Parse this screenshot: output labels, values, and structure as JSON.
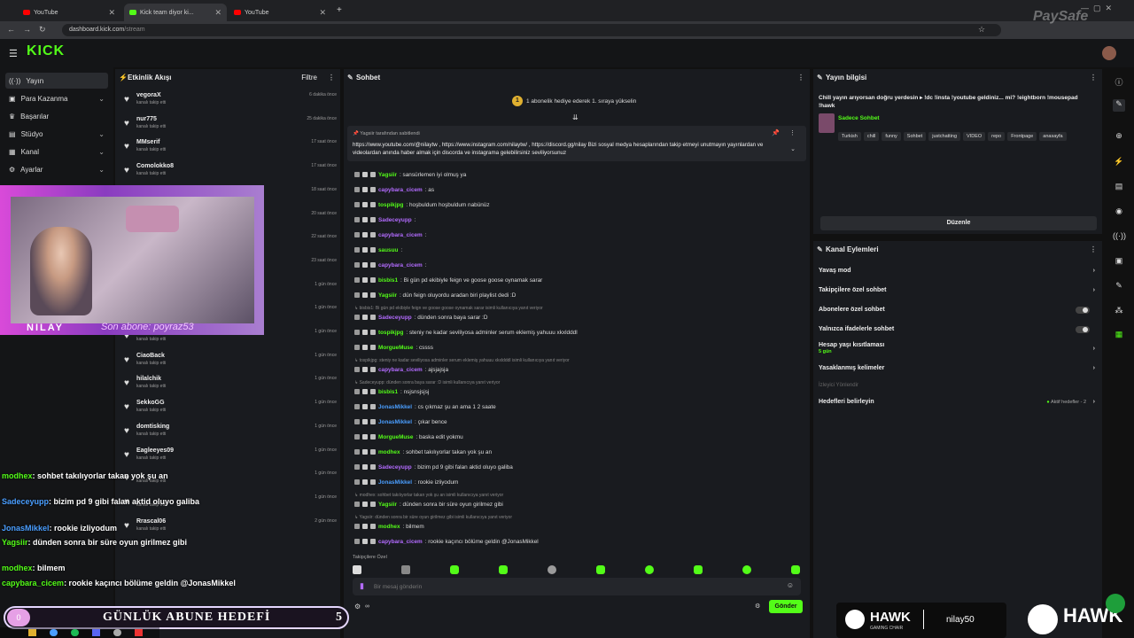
{
  "browser": {
    "tabs": [
      {
        "label": "YouTube",
        "active": false
      },
      {
        "label": "Kick team diyor ki...",
        "active": true
      },
      {
        "label": "YouTube",
        "active": false
      }
    ],
    "url_domain": "dashboard.kick.com",
    "url_path": "/stream"
  },
  "brand": {
    "logo": "KICK",
    "accent": "#53fc18"
  },
  "sidebar": {
    "items": [
      {
        "label": "Yayın",
        "icon": "broadcast-icon",
        "selected": true,
        "has_chevron": false
      },
      {
        "label": "Para Kazanma",
        "icon": "money-icon",
        "has_chevron": true
      },
      {
        "label": "Başarılar",
        "icon": "trophy-icon",
        "has_chevron": false
      },
      {
        "label": "Stüdyo",
        "icon": "studio-icon",
        "has_chevron": true
      },
      {
        "label": "Kanal",
        "icon": "channel-icon",
        "has_chevron": true
      },
      {
        "label": "Ayarlar",
        "icon": "gear-icon",
        "has_chevron": true
      }
    ]
  },
  "activity": {
    "title": "Etkinlik Akışı",
    "filter_label": "Filtre",
    "items": [
      {
        "name": "vegoraX",
        "sub": "kanalı takip etti",
        "time": "6 dakika önce"
      },
      {
        "name": "nur775",
        "sub": "kanalı takip etti",
        "time": "25 dakika önce"
      },
      {
        "name": "MMserif",
        "sub": "kanalı takip etti",
        "time": "17 saat önce"
      },
      {
        "name": "Comolokko8",
        "sub": "kanalı takip etti",
        "time": "17 saat önce"
      },
      {
        "name": "",
        "sub": "",
        "time": "18 saat önce"
      },
      {
        "name": "",
        "sub": "",
        "time": "20 saat önce"
      },
      {
        "name": "",
        "sub": "",
        "time": "22 saat önce"
      },
      {
        "name": "",
        "sub": "",
        "time": "23 saat önce"
      },
      {
        "name": "",
        "sub": "",
        "time": "1 gün önce"
      },
      {
        "name": "",
        "sub": "",
        "time": "1 gün önce"
      },
      {
        "name": "",
        "sub": "kanalı takip etti",
        "time": "1 gün önce"
      },
      {
        "name": "CiaoBack",
        "sub": "kanalı takip etti",
        "time": "1 gün önce"
      },
      {
        "name": "hilalchik",
        "sub": "kanalı takip etti",
        "time": "1 gün önce"
      },
      {
        "name": "SekkoGG",
        "sub": "kanalı takip etti",
        "time": "1 gün önce"
      },
      {
        "name": "domtisking",
        "sub": "kanalı takip etti",
        "time": "1 gün önce"
      },
      {
        "name": "Eagleeyes09",
        "sub": "kanalı takip etti",
        "time": "1 gün önce"
      },
      {
        "name": "",
        "sub": "kanalı takip etti",
        "time": "1 gün önce"
      },
      {
        "name": "",
        "sub": "kanalı takip etti",
        "time": "1 gün önce"
      },
      {
        "name": "Rrascal06",
        "sub": "kanalı takip etti",
        "time": "2 gün önce"
      }
    ]
  },
  "chat": {
    "title": "Sohbet",
    "gift_banner": "1 abonelik hediye ederek 1. sıraya yükselin",
    "pinned_by": "Yagsiir tarafından sabitlendi",
    "pinned_text": "https://www.youtube.com/@nilaytw , https://www.instagram.com/nilaytw/ , https://discord.gg/nilay Bizi sosyal medya hesaplarından takip etmeyi unutmayın yayınlardan ve videolardan anında haber almak için discorda ve instagrama gelebilirsiniz seviliyorsunuz",
    "messages": [
      {
        "kind": "msg",
        "user": "Yagsiir",
        "color": "#53fc18",
        "text": ": sansürlemen iyi olmuş ya"
      },
      {
        "kind": "msg",
        "user": "capybara_cicem",
        "color": "#b36bff",
        "text": ": as"
      },
      {
        "kind": "msg",
        "user": "tospikjpg",
        "color": "#53fc18",
        "text": ": hoşbuldum hoşbuldum nabünüz"
      },
      {
        "kind": "msg",
        "user": "Sadeceyupp",
        "color": "#b36bff",
        "text": ":"
      },
      {
        "kind": "msg",
        "user": "capybara_cicem",
        "color": "#b36bff",
        "text": ":"
      },
      {
        "kind": "msg",
        "user": "sausuu",
        "color": "#53fc18",
        "text": ":"
      },
      {
        "kind": "msg",
        "user": "capybara_cicem",
        "color": "#b36bff",
        "text": ":"
      },
      {
        "kind": "msg",
        "user": "bisbis1",
        "color": "#53fc18",
        "text": ": Bi gün pd ekibiyle feign ve goose goose oynamak sarar"
      },
      {
        "kind": "msg",
        "user": "Yagsiir",
        "color": "#53fc18",
        "text": ": dün feign oluyordu aradan biri playlist dedi :D"
      },
      {
        "kind": "reply",
        "text": "bisbis1: Bi gün pd ekibiyle feign ve goose goose oynamak sarar isimli kullanıcıya yanıt veriyor"
      },
      {
        "kind": "msg",
        "user": "Sadeceyupp",
        "color": "#b36bff",
        "text": ": dünden sonra baya sarar :D"
      },
      {
        "kind": "msg",
        "user": "tospikjpg",
        "color": "#53fc18",
        "text": ": steniy ne kadar seviliyosa adminler serum eklemiş yahuuu xkxldddl"
      },
      {
        "kind": "msg",
        "user": "MorgueMuse",
        "color": "#53fc18",
        "text": ": cssss"
      },
      {
        "kind": "reply",
        "text": "tospikjpg: steniy ne kadar seviliyosa adminler serum eklemiş yahuuu xkxldddl isimli kullanıcıya yanıt veriyor"
      },
      {
        "kind": "msg",
        "user": "capybara_cicem",
        "color": "#b36bff",
        "text": ": ajsjajsja"
      },
      {
        "kind": "reply",
        "text": "Sadeceyupp: dünden sonra baya sarar :D isimli kullanıcıya yanıt veriyor"
      },
      {
        "kind": "msg",
        "user": "bisbis1",
        "color": "#53fc18",
        "text": ": nsjsnsjsjsj"
      },
      {
        "kind": "msg",
        "user": "JonasMikkel",
        "color": "#4a9eff",
        "text": ": cs çıkmaz şu an ama 1 2 saate"
      },
      {
        "kind": "msg",
        "user": "JonasMikkel",
        "color": "#4a9eff",
        "text": ": çıkar bence"
      },
      {
        "kind": "msg",
        "user": "MorgueMuse",
        "color": "#53fc18",
        "text": ": baska edit yokmu"
      },
      {
        "kind": "msg",
        "user": "modhex",
        "color": "#53fc18",
        "text": ": sohbet takılıyorlar takan yok şu an"
      },
      {
        "kind": "msg",
        "user": "Sadeceyupp",
        "color": "#b36bff",
        "text": ": bizim pd 9 gibi falan aktid oluyo galiba"
      },
      {
        "kind": "msg",
        "user": "JonasMikkel",
        "color": "#4a9eff",
        "text": ": rookie izliyodum"
      },
      {
        "kind": "reply",
        "text": "modhex: sohbet takılıyorlar takan yok şu an isimli kullanıcıya yanıt veriyor"
      },
      {
        "kind": "msg",
        "user": "Yagsiir",
        "color": "#53fc18",
        "text": ": dünden sonra bir süre oyun girilmez gibi"
      },
      {
        "kind": "reply",
        "text": "Yagsiir: dünden sonra bir süre oyun girilmez gibi isimli kullanıcıya yanıt veriyor"
      },
      {
        "kind": "msg",
        "user": "modhex",
        "color": "#53fc18",
        "text": ": bilmem"
      },
      {
        "kind": "msg",
        "user": "capybara_cicem",
        "color": "#b36bff",
        "text": ": rookie kaçıncı bölüme geldin @JonasMikkel"
      }
    ],
    "followers_only_label": "Takipçilere Özel",
    "input_placeholder": "Bir mesaj gönderin",
    "send_label": "Gönder",
    "infinity_label": "∞"
  },
  "stream_info": {
    "title": "Yayın bilgisi",
    "description": "Chill yayın arıyorsan doğru yerdesin ▸ !dc !insta !youtube geldiniz... mi? !eightborn !mousepad !hawk",
    "category": "Sadece Sohbet",
    "tags": [
      "Turkish",
      "chill",
      "funny",
      "Sohbet",
      "justchatting",
      "VIDEO",
      "repo",
      "Frontpage",
      "anasayfa"
    ],
    "edit_label": "Düzenle"
  },
  "channel_actions": {
    "title": "Kanal Eylemleri",
    "items": [
      {
        "label": "Yavaş mod",
        "type": "chevron"
      },
      {
        "label": "Takipçilere özel sohbet",
        "type": "chevron"
      },
      {
        "label": "Abonelere özel sohbet",
        "type": "toggle"
      },
      {
        "label": "Yalnızca ifadelerle sohbet",
        "type": "toggle"
      },
      {
        "label": "Hesap yaşı kısıtlaması",
        "sub": "5 gün",
        "type": "chevron"
      },
      {
        "label": "Yasaklanmış kelimeler",
        "type": "chevron"
      },
      {
        "label": "İzleyici Yönlendir",
        "type": "disabled"
      },
      {
        "label": "Hedefleri belirleyin",
        "status": "Aktif hedefler - 2",
        "type": "chevron"
      }
    ]
  },
  "overlay": {
    "cam_name": "NILAY",
    "last_sub": "Son abone: poyraz53",
    "chat_lines": [
      {
        "user": "modhex",
        "text": ": sohbet takılıyorlar takan yok şu an"
      },
      {
        "user": "Sadeceyupp",
        "text": ": bizim pd 9 gibi falan aktid oluyo galiba"
      },
      {
        "user": "JonasMikkel",
        "text": ": rookie izliyodum"
      },
      {
        "user": "Yagsiir",
        "text": ": dünden sonra bir süre oyun girilmez gibi"
      },
      {
        "user": "modhex",
        "text": ": bilmem"
      },
      {
        "user": "capybara_cicem",
        "text": ": rookie kaçıncı bölüme geldin @JonasMikkel"
      }
    ],
    "goal_label": "GÜNLÜK ABUNE HEDEFİ",
    "goal_value": "5",
    "goal_current": "0",
    "sponsor_name": "HAWK",
    "sponsor_sub": "GAMING CHAIR",
    "sponsor_code": "nilay50",
    "watermark": "PaySafe"
  }
}
